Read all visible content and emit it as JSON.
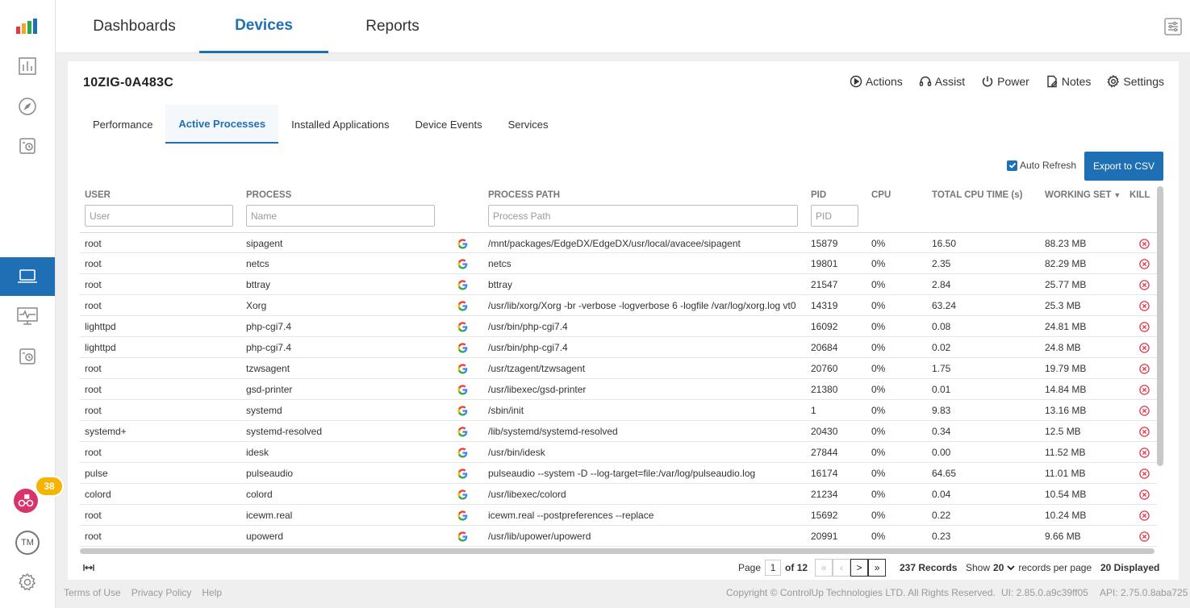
{
  "nav": {
    "tabs": [
      {
        "label": "Dashboards"
      },
      {
        "label": "Devices"
      },
      {
        "label": "Reports"
      }
    ]
  },
  "badge": {
    "count": "38"
  },
  "avatar": {
    "initials": "TM"
  },
  "device": {
    "name": "10ZIG-0A483C"
  },
  "actions": [
    {
      "label": "Actions",
      "icon": "play-circle-icon"
    },
    {
      "label": "Assist",
      "icon": "headset-icon"
    },
    {
      "label": "Power",
      "icon": "power-icon"
    },
    {
      "label": "Notes",
      "icon": "notes-icon"
    },
    {
      "label": "Settings",
      "icon": "gear-icon"
    }
  ],
  "subtabs": [
    {
      "label": "Performance"
    },
    {
      "label": "Active Processes"
    },
    {
      "label": "Installed Applications"
    },
    {
      "label": "Device Events"
    },
    {
      "label": "Services"
    }
  ],
  "toolbar": {
    "auto_refresh": "Auto Refresh",
    "auto_refresh_checked": true,
    "export_label": "Export to CSV"
  },
  "columns": {
    "user": "USER",
    "process": "PROCESS",
    "path": "PROCESS PATH",
    "pid": "PID",
    "cpu": "CPU",
    "total_cpu": "TOTAL CPU TIME (s)",
    "working_set": "WORKING SET",
    "kill": "KILL"
  },
  "filters": {
    "user": "User",
    "process": "Name",
    "path": "Process Path",
    "pid": "PID"
  },
  "rows": [
    {
      "user": "root",
      "process": "sipagent",
      "path": "/mnt/packages/EdgeDX/EdgeDX/usr/local/avacee/sipagent",
      "pid": "15879",
      "cpu": "0%",
      "total": "16.50",
      "ws": "88.23 MB"
    },
    {
      "user": "root",
      "process": "netcs",
      "path": "netcs",
      "pid": "19801",
      "cpu": "0%",
      "total": "2.35",
      "ws": "82.29 MB"
    },
    {
      "user": "root",
      "process": "bttray",
      "path": "bttray",
      "pid": "21547",
      "cpu": "0%",
      "total": "2.84",
      "ws": "25.77 MB"
    },
    {
      "user": "root",
      "process": "Xorg",
      "path": "/usr/lib/xorg/Xorg -br -verbose -logverbose 6 -logfile /var/log/xorg.log vt0",
      "pid": "14319",
      "cpu": "0%",
      "total": "63.24",
      "ws": "25.3 MB"
    },
    {
      "user": "lighttpd",
      "process": "php-cgi7.4",
      "path": "/usr/bin/php-cgi7.4",
      "pid": "16092",
      "cpu": "0%",
      "total": "0.08",
      "ws": "24.81 MB"
    },
    {
      "user": "lighttpd",
      "process": "php-cgi7.4",
      "path": "/usr/bin/php-cgi7.4",
      "pid": "20684",
      "cpu": "0%",
      "total": "0.02",
      "ws": "24.8 MB"
    },
    {
      "user": "root",
      "process": "tzwsagent",
      "path": "/usr/tzagent/tzwsagent",
      "pid": "20760",
      "cpu": "0%",
      "total": "1.75",
      "ws": "19.79 MB"
    },
    {
      "user": "root",
      "process": "gsd-printer",
      "path": "/usr/libexec/gsd-printer",
      "pid": "21380",
      "cpu": "0%",
      "total": "0.01",
      "ws": "14.84 MB"
    },
    {
      "user": "root",
      "process": "systemd",
      "path": "/sbin/init",
      "pid": "1",
      "cpu": "0%",
      "total": "9.83",
      "ws": "13.16 MB"
    },
    {
      "user": "systemd+",
      "process": "systemd-resolved",
      "path": "/lib/systemd/systemd-resolved",
      "pid": "20430",
      "cpu": "0%",
      "total": "0.34",
      "ws": "12.5 MB"
    },
    {
      "user": "root",
      "process": "idesk",
      "path": "/usr/bin/idesk",
      "pid": "27844",
      "cpu": "0%",
      "total": "0.00",
      "ws": "11.52 MB"
    },
    {
      "user": "pulse",
      "process": "pulseaudio",
      "path": "pulseaudio --system -D --log-target=file:/var/log/pulseaudio.log",
      "pid": "16174",
      "cpu": "0%",
      "total": "64.65",
      "ws": "11.01 MB"
    },
    {
      "user": "colord",
      "process": "colord",
      "path": "/usr/libexec/colord",
      "pid": "21234",
      "cpu": "0%",
      "total": "0.04",
      "ws": "10.54 MB"
    },
    {
      "user": "root",
      "process": "icewm.real",
      "path": "icewm.real --postpreferences --replace",
      "pid": "15692",
      "cpu": "0%",
      "total": "0.22",
      "ws": "10.24 MB"
    },
    {
      "user": "root",
      "process": "upowerd",
      "path": "/usr/lib/upower/upowerd",
      "pid": "20991",
      "cpu": "0%",
      "total": "0.23",
      "ws": "9.66 MB"
    }
  ],
  "pager": {
    "page_label": "Page",
    "page": "1",
    "of_label": "of 12",
    "first": "«",
    "prev": "‹",
    "next": ">",
    "last": "»",
    "records": "237 Records",
    "show_label": "Show",
    "per_page": "20",
    "per_page_suffix": "records per page",
    "displayed": "20 Displayed"
  },
  "footer": {
    "links": [
      "Terms of Use",
      "Privacy Policy",
      "Help"
    ],
    "copyright": "Copyright © ControlUp Technologies LTD. All Rights Reserved.",
    "ui_version": "UI: 2.85.0.a9c39ff05",
    "api_version": "API: 2.75.0.8aba725"
  },
  "colors": {
    "accent": "#1f6fb5",
    "kill": "#e0384a",
    "badge": "#f5b400"
  }
}
